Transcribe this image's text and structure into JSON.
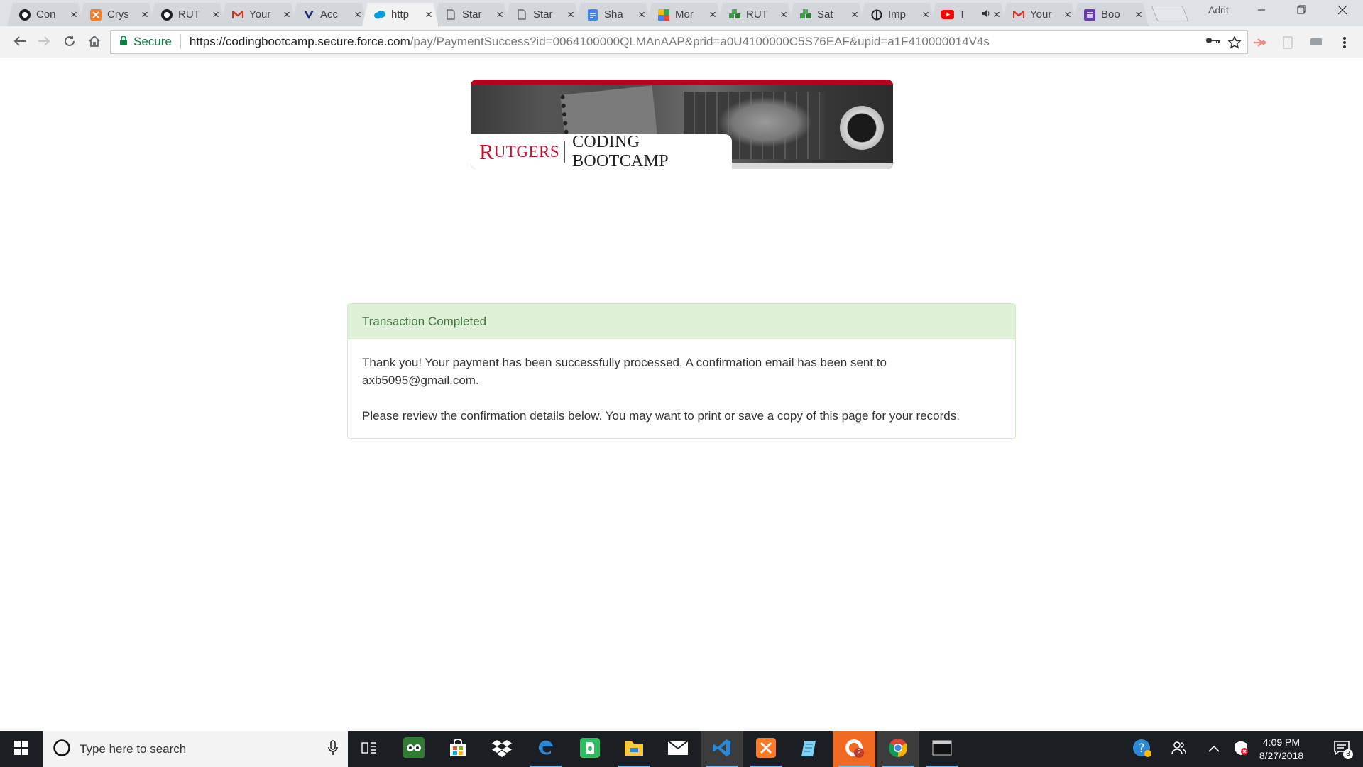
{
  "browser": {
    "tabs": [
      {
        "title": "Con",
        "icon": "github-icon"
      },
      {
        "title": "Crys",
        "icon": "xampp-icon"
      },
      {
        "title": "RUT",
        "icon": "github-icon"
      },
      {
        "title": "Your",
        "icon": "gmail-icon"
      },
      {
        "title": "Acc",
        "icon": "v-logo-icon"
      },
      {
        "title": "http",
        "icon": "salesforce-cloud-icon",
        "active": true
      },
      {
        "title": "Star",
        "icon": "document-icon"
      },
      {
        "title": "Star",
        "icon": "document-icon"
      },
      {
        "title": "Sha",
        "icon": "google-docs-icon"
      },
      {
        "title": "Mor",
        "icon": "colorful-grid-icon"
      },
      {
        "title": "RUT",
        "icon": "cubes-icon"
      },
      {
        "title": "Sat",
        "icon": "cubes-icon"
      },
      {
        "title": "Imp",
        "icon": "o-logo-icon"
      },
      {
        "title": "T",
        "icon": "youtube-icon",
        "audio": true
      },
      {
        "title": "Your",
        "icon": "gmail-icon"
      },
      {
        "title": "Boo",
        "icon": "list-icon"
      }
    ],
    "profile_name": "Adrit",
    "secure_label": "Secure",
    "url_host": "https://codingbootcamp.secure.force.com",
    "url_rest": "/pay/PaymentSuccess?id=0064100000QLMAnAAP&prid=a0U4100000C5S76EAF&upid=a1F410000014V4s"
  },
  "page": {
    "brand": {
      "rutgers_initial": "R",
      "rutgers_rest": "UTGERS",
      "program": "CODING BOOTCAMP",
      "accent_color": "#c8102e"
    },
    "panel": {
      "heading": "Transaction Completed",
      "message_1": "Thank you! Your payment has been successfully processed. A confirmation email has been sent to axb5095@gmail.com.",
      "message_2": "Please review the confirmation details below. You may want to print or save a copy of this page for your records."
    }
  },
  "taskbar": {
    "search_placeholder": "Type here to search",
    "apps": [
      "task-view",
      "tripadvisor",
      "store",
      "dropbox",
      "edge",
      "evernote",
      "file-explorer",
      "mail",
      "vscode",
      "xampp",
      "notepad",
      "app-with-badge",
      "chrome",
      "terminal"
    ],
    "clock_time": "4:09 PM",
    "clock_date": "8/27/2018",
    "notification_count": "3",
    "app_badge_count": "2"
  }
}
